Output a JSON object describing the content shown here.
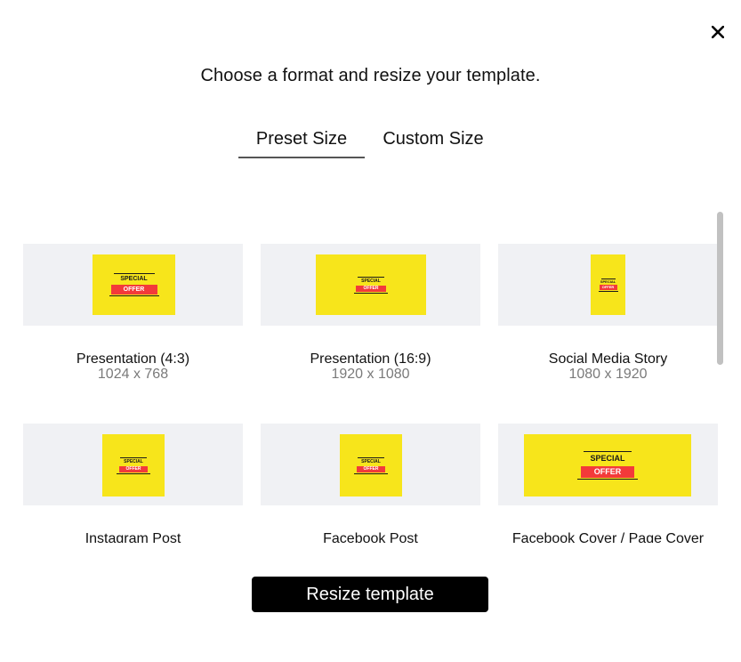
{
  "dialog": {
    "heading": "Choose a format and resize your template.",
    "close_icon": "close-icon"
  },
  "tabs": [
    {
      "label": "Preset Size",
      "active": true
    },
    {
      "label": "Custom Size",
      "active": false
    }
  ],
  "thumbnail_text": {
    "line1": "SPECIAL",
    "line2": "OFFER"
  },
  "presets": [
    {
      "title": "Presentation (4:3)",
      "dims": "1024 x 768"
    },
    {
      "title": "Presentation (16:9)",
      "dims": "1920 x 1080"
    },
    {
      "title": "Social Media Story",
      "dims": "1080 x 1920"
    },
    {
      "title": "Instagram Post",
      "dims": ""
    },
    {
      "title": "Facebook Post",
      "dims": ""
    },
    {
      "title": "Facebook Cover / Page Cover",
      "dims": ""
    }
  ],
  "colors": {
    "poster_bg": "#f7e51b",
    "offer_red": "#f33a3a",
    "thumb_bg": "#f0f1f4"
  },
  "footer": {
    "resize_label": "Resize template"
  }
}
